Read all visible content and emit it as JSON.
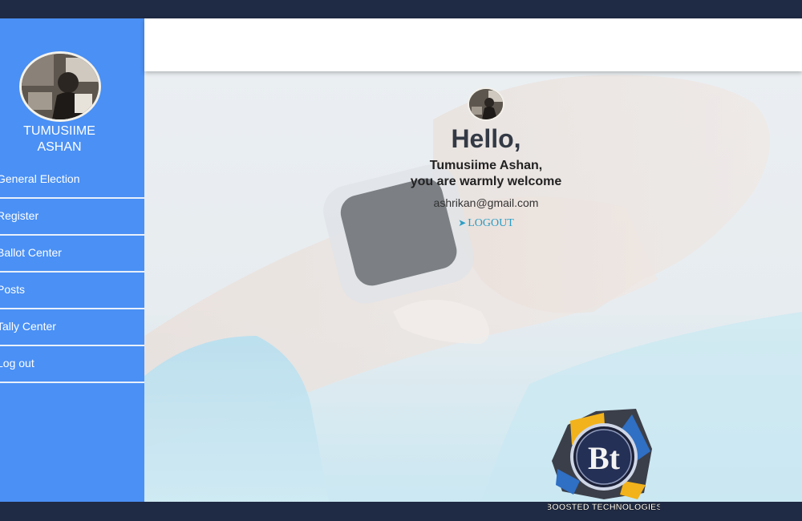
{
  "sidebar": {
    "user_name": "TUMUSIIME ASHAN",
    "items": [
      {
        "label": "General Election"
      },
      {
        "label": "Register"
      },
      {
        "label": "Ballot Center"
      },
      {
        "label": "Posts"
      },
      {
        "label": "Tally Center"
      },
      {
        "label": "Log out"
      }
    ]
  },
  "main": {
    "greeting": "Hello,",
    "welcome_name": "Tumusiime Ashan,",
    "welcome_text": "you are warmly welcome",
    "email": "ashrikan@gmail.com",
    "logout_label": "LOGOUT",
    "logout_icon": "sign-out-icon"
  },
  "watermark": {
    "initials": "Bt",
    "brand_text": "BOOSTED TECHNOLOGIES"
  },
  "colors": {
    "sidebar": "#4a90f5",
    "top_bar": "#1f2a44",
    "logout_link": "#2a9dc4"
  }
}
